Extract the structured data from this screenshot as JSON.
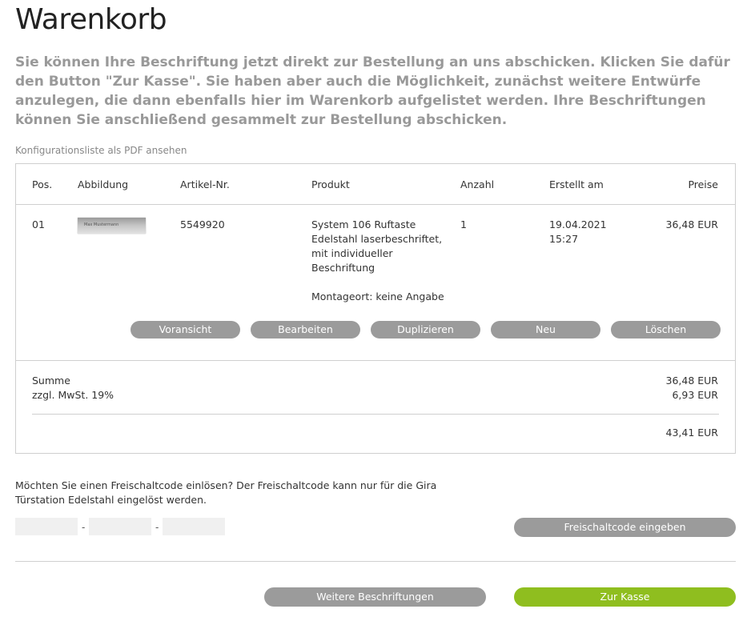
{
  "page": {
    "title": "Warenkorb",
    "intro": "Sie können Ihre Beschriftung jetzt direkt zur Bestellung an uns abschicken. Klicken Sie dafür den Button \"Zur Kasse\". Sie haben aber auch die Möglichkeit, zunächst weitere Entwürfe anzulegen, die dann ebenfalls hier im Warenkorb aufgelistet werden. Ihre Beschriftungen können Sie anschließend gesammelt zur Bestellung abschicken.",
    "pdf_link": "Konfigurationsliste als PDF ansehen"
  },
  "table": {
    "headers": {
      "pos": "Pos.",
      "image": "Abbildung",
      "article": "Artikel-Nr.",
      "product": "Produkt",
      "quantity": "Anzahl",
      "created": "Erstellt am",
      "price": "Preise"
    },
    "row": {
      "pos": "01",
      "thumb_text": "Max Mustermann",
      "article": "5549920",
      "product_line1": "System 106 Ruftaste",
      "product_line2": "Edelstahl laserbeschriftet,",
      "product_line3": "mit individueller",
      "product_line4": "Beschriftung",
      "mount": "Montageort: keine Angabe",
      "quantity": "1",
      "date": "19.04.2021",
      "time": "15:27",
      "price": "36,48 EUR"
    },
    "actions": {
      "preview": "Voransicht",
      "edit": "Bearbeiten",
      "duplicate": "Duplizieren",
      "new": "Neu",
      "delete": "Löschen"
    },
    "totals": {
      "sum_label": "Summe",
      "sum_value": "36,48 EUR",
      "vat_label": "zzgl. MwSt. 19%",
      "vat_value": "6,93 EUR",
      "total_value": "43,41 EUR"
    }
  },
  "voucher": {
    "question": "Möchten Sie einen Freischaltcode einlösen? Der Freischaltcode kann nur für die Gira Türstation Edelstahl eingelöst werden.",
    "separator": "-",
    "button": "Freischaltcode eingeben"
  },
  "footer": {
    "more_button": "Weitere Beschriftungen",
    "checkout_button": "Zur Kasse"
  },
  "colors": {
    "button_gray": "#9b9b9b",
    "checkout_green": "#8fbe1f",
    "intro_text": "#999999"
  }
}
